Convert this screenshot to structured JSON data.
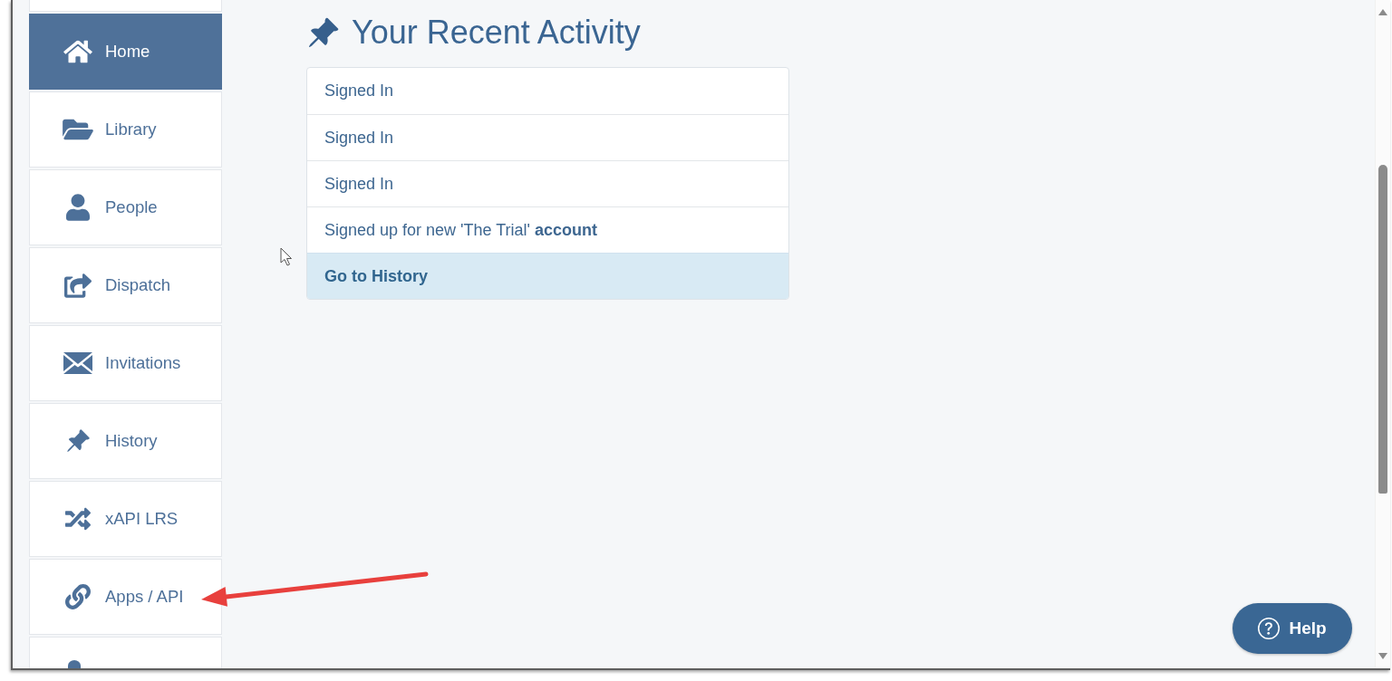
{
  "sidebar": {
    "items": [
      {
        "label": "Home",
        "selected": true
      },
      {
        "label": "Library",
        "selected": false
      },
      {
        "label": "People",
        "selected": false
      },
      {
        "label": "Dispatch",
        "selected": false
      },
      {
        "label": "Invitations",
        "selected": false
      },
      {
        "label": "History",
        "selected": false
      },
      {
        "label": "xAPI LRS",
        "selected": false
      },
      {
        "label": "Apps / API",
        "selected": false
      }
    ]
  },
  "recent_activity": {
    "title": "Your Recent Activity",
    "rows": [
      {
        "kind": "entry",
        "text": "Signed In"
      },
      {
        "kind": "entry",
        "text": "Signed In"
      },
      {
        "kind": "entry",
        "text": "Signed In"
      },
      {
        "kind": "entry",
        "text": "Signed up for new 'The Trial' **account**"
      },
      {
        "kind": "link",
        "text": "Go to History"
      }
    ]
  },
  "help_button": {
    "label": "Help"
  }
}
